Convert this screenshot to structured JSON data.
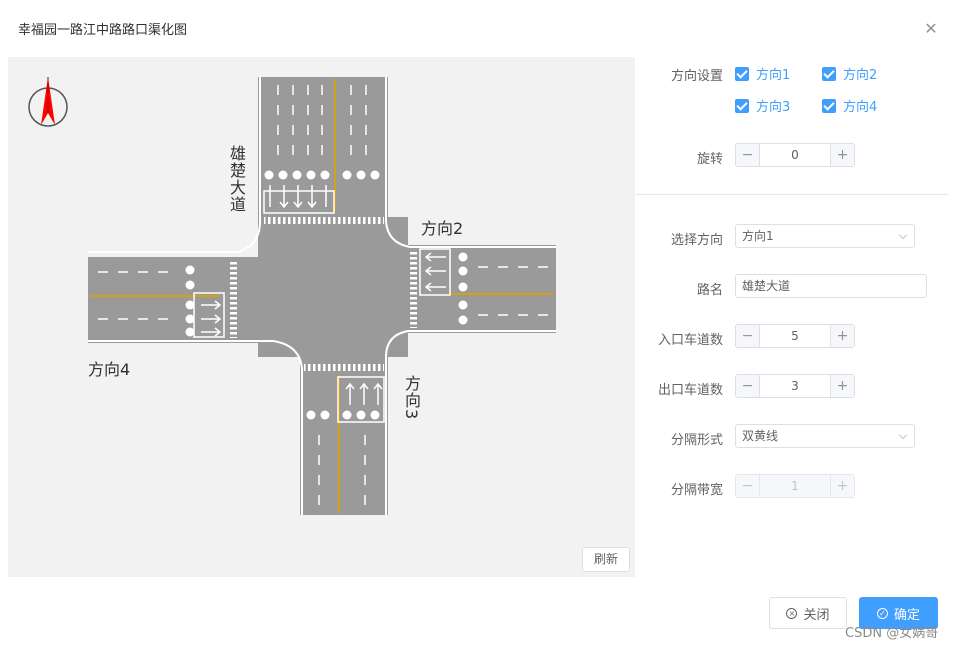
{
  "dialog": {
    "title": "幸福园一路江中路路口渠化图",
    "close_icon": "close-icon"
  },
  "canvas": {
    "roads": {
      "north": "雄楚大道",
      "east": "方向2",
      "south": "方向3",
      "west": "方向4"
    },
    "refresh_label": "刷新",
    "colors": {
      "background": "#f2f2f2",
      "asphalt": "#9a9a9a",
      "median": "#d4a017",
      "marking": "#ffffff",
      "compass": "#ff0000"
    }
  },
  "form": {
    "direction_settings": {
      "label": "方向设置",
      "options": [
        {
          "label": "方向1",
          "checked": true
        },
        {
          "label": "方向2",
          "checked": true
        },
        {
          "label": "方向3",
          "checked": true
        },
        {
          "label": "方向4",
          "checked": true
        }
      ]
    },
    "rotate": {
      "label": "旋转",
      "value": "0"
    },
    "select_direction": {
      "label": "选择方向",
      "value": "方向1"
    },
    "road_name": {
      "label": "路名",
      "value": "雄楚大道"
    },
    "entry_lanes": {
      "label": "入口车道数",
      "value": "5"
    },
    "exit_lanes": {
      "label": "出口车道数",
      "value": "3"
    },
    "separation": {
      "label": "分隔形式",
      "value": "双黄线"
    },
    "separation_width": {
      "label": "分隔带宽",
      "value": "1"
    }
  },
  "footer": {
    "close_label": "关闭",
    "confirm_label": "确定",
    "watermark": "CSDN @女娲哥"
  },
  "accent_color": "#409eff"
}
